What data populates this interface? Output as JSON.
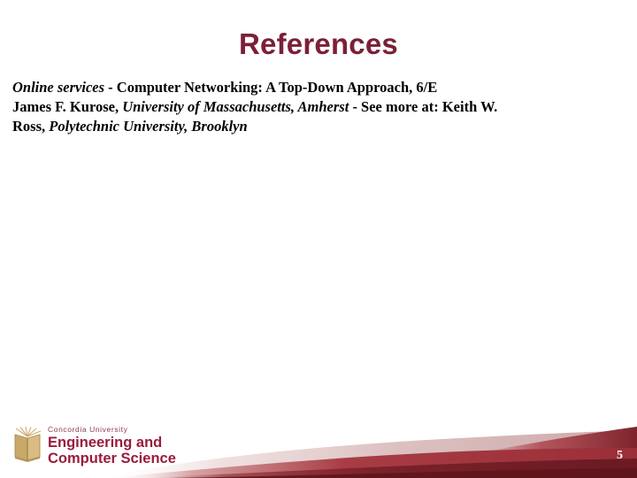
{
  "slide": {
    "title": "References",
    "page_number": "5",
    "background_color": "#ffffff",
    "title_color": "#7B2038"
  },
  "reference": {
    "lines": [
      {
        "segments": [
          {
            "text": "Online services",
            "style": "bold-italic"
          },
          {
            "text": " - ",
            "style": "bold"
          },
          {
            "text": "Computer Networking: A Top-Down Approach, 6/E",
            "style": "bold"
          }
        ]
      },
      {
        "segments": [
          {
            "text": "James F. Kurose, ",
            "style": "bold"
          },
          {
            "text": "University of Massachusetts, Amherst",
            "style": "bold-italic"
          },
          {
            "text": " - See more at: Keith W.",
            "style": "bold"
          }
        ]
      },
      {
        "segments": [
          {
            "text": "Ross, ",
            "style": "bold"
          },
          {
            "text": "Polytechnic University, Brooklyn",
            "style": "bold-italic"
          }
        ]
      }
    ],
    "line1_a": "Online services",
    "line1_b": " - ",
    "line1_c": "Computer Networking: A Top-Down Approach, 6/E",
    "line2_a": "James F. Kurose, ",
    "line2_b": "University of Massachusetts, Amherst",
    "line2_c": " - See more at: Keith W.",
    "line3_a": "Ross, ",
    "line3_b": "Polytechnic University, Brooklyn"
  },
  "logo": {
    "university": "Concordia University",
    "faculty_line1": "Engineering and",
    "faculty_line2": "Computer Science",
    "icon": "open-book-icon",
    "text_color": "#9B1B3C",
    "university_color": "#8C3A4A",
    "book_color": "#C9A96A"
  },
  "decoration": {
    "wave_colors": [
      "#E8D2D2",
      "#B5424A",
      "#8E2B34",
      "#6E1D26",
      "#A33640"
    ]
  }
}
